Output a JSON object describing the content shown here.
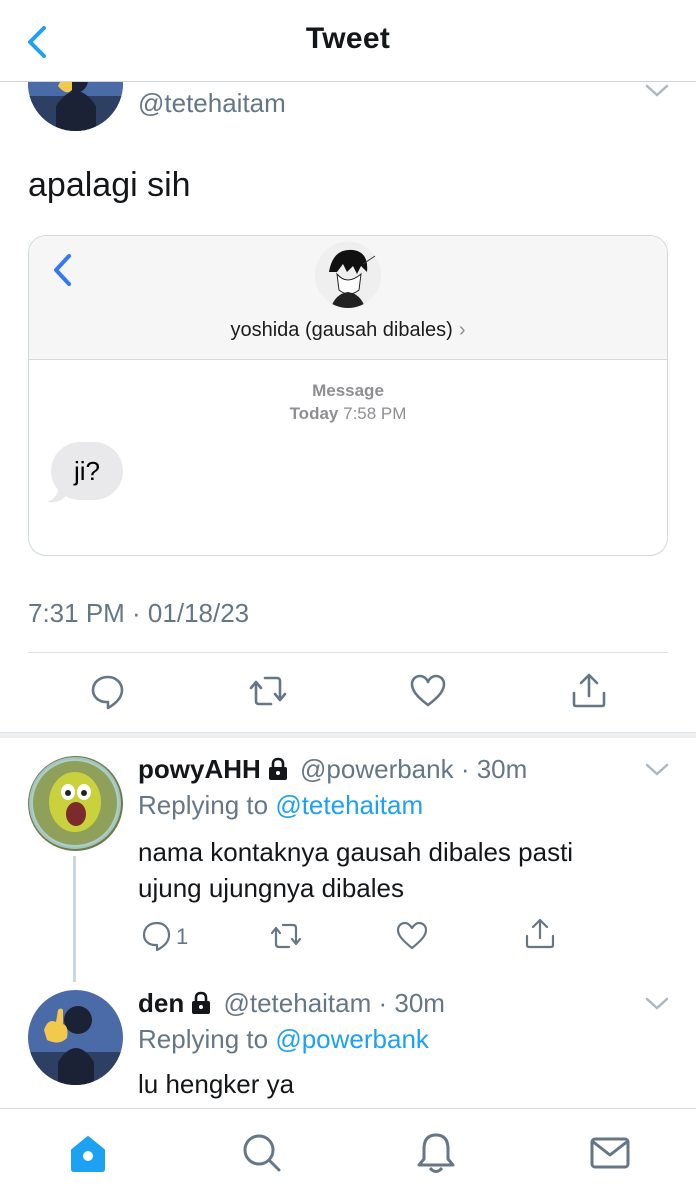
{
  "header": {
    "title": "Tweet",
    "back_icon": "chevron-left-icon"
  },
  "tweet": {
    "handle": "@tetehaitam",
    "text": "apalagi sih",
    "timestamp": "7:31 PM · 01/18/23",
    "embedded_screenshot": {
      "contact_name": "yoshida (gausah dibales)",
      "contact_chevron": "›",
      "message_label": "Message",
      "time_day": "Today",
      "time_clock": "7:58 PM",
      "bubble_text": "ji?"
    },
    "actions": [
      "reply-icon",
      "retweet-icon",
      "like-icon",
      "share-icon"
    ]
  },
  "replies": [
    {
      "name": "powyAHH",
      "handle": "@powerbank",
      "time": "30m",
      "replying_prefix": "Replying to",
      "replying_to": "@tetehaitam",
      "text": "nama kontaknya gausah dibales pasti ujung ujungnya dibales",
      "reply_count": "1"
    },
    {
      "name": "den",
      "handle": "@tetehaitam",
      "time": "30m",
      "replying_prefix": "Replying to",
      "replying_to": "@powerbank",
      "text": "lu hengker ya"
    }
  ],
  "tabbar": {
    "items": [
      "home-icon",
      "search-icon",
      "notifications-icon",
      "messages-icon"
    ],
    "active_color": "#1da1f2"
  },
  "colors": {
    "accent": "#1da1f2",
    "secondary_text": "#657786",
    "primary_text": "#14171a"
  }
}
